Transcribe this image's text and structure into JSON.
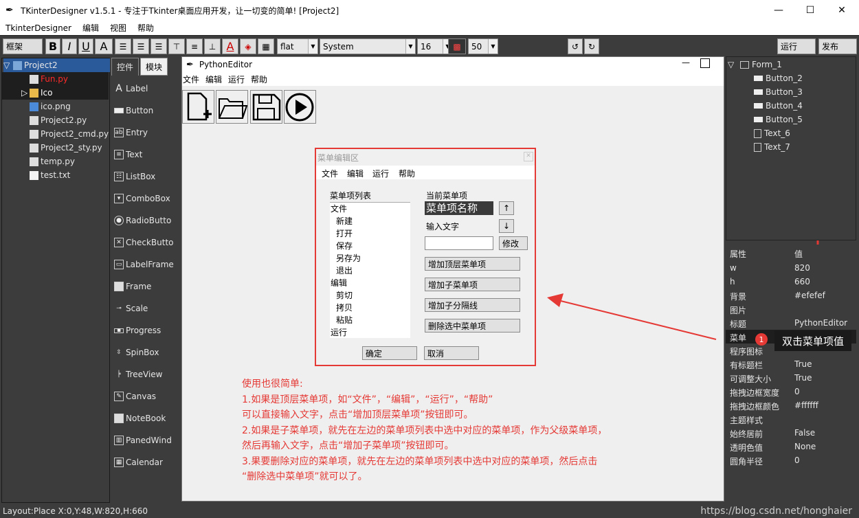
{
  "window": {
    "title": "TKinterDesigner v1.5.1 - 专注于Tkinter桌面应用开发，让一切变的简单!   [Project2]",
    "minimize": "—",
    "maximize": "☐",
    "close": "✕"
  },
  "menubar": [
    "TkinterDesigner",
    "编辑",
    "视图",
    "帮助"
  ],
  "toolbar": {
    "frame_label": "框架",
    "bold": "B",
    "italic": "I",
    "underline": "U",
    "font_color": "A",
    "relief": "flat",
    "font": "System",
    "size": "16",
    "alpha": "50",
    "run": "运行",
    "publish": "发布"
  },
  "project_tree": [
    {
      "label": "Project2",
      "icon": "project-icon",
      "color": "#e6e6e6"
    },
    {
      "label": "Fun.py",
      "icon": "python-file-icon",
      "color": "#ff2a2a"
    },
    {
      "label": "Ico",
      "icon": "folder-icon",
      "color": "#ffffff"
    },
    {
      "label": "ico.png",
      "icon": "image-file-icon",
      "color": "#e6e6e6"
    },
    {
      "label": "Project2.py",
      "icon": "python-file-icon",
      "color": "#e6e6e6"
    },
    {
      "label": "Project2_cmd.py",
      "icon": "python-file-icon",
      "color": "#e6e6e6"
    },
    {
      "label": "Project2_sty.py",
      "icon": "python-file-icon",
      "color": "#e6e6e6"
    },
    {
      "label": "temp.py",
      "icon": "python-file-icon",
      "color": "#e6e6e6"
    },
    {
      "label": "test.txt",
      "icon": "text-file-icon",
      "color": "#e6e6e6"
    }
  ],
  "control_tabs": [
    "控件",
    "模块"
  ],
  "controls": [
    "Label",
    "Button",
    "Entry",
    "Text",
    "ListBox",
    "ComboBox",
    "RadioButto",
    "CheckButto",
    "LabelFrame",
    "Frame",
    "Scale",
    "Progress",
    "SpinBox",
    "TreeView",
    "Canvas",
    "NoteBook",
    "PanedWind",
    "Calendar"
  ],
  "form": {
    "title": "PythonEditor",
    "menu": [
      "文件",
      "编辑",
      "运行",
      "帮助"
    ],
    "toolbar_icons": [
      "new-file-icon",
      "open-folder-icon",
      "save-icon",
      "play-icon"
    ]
  },
  "dialog": {
    "title": "菜单编辑区",
    "menu": [
      "文件",
      "编辑",
      "运行",
      "帮助"
    ],
    "list_label": "菜单项列表",
    "list_items": [
      {
        "text": "文件",
        "indent": 0
      },
      {
        "text": "新建",
        "indent": 1
      },
      {
        "text": "打开",
        "indent": 1
      },
      {
        "text": "保存",
        "indent": 1
      },
      {
        "text": "另存为",
        "indent": 1
      },
      {
        "text": "退出",
        "indent": 1
      },
      {
        "text": "编辑",
        "indent": 0
      },
      {
        "text": "剪切",
        "indent": 1
      },
      {
        "text": "拷贝",
        "indent": 1
      },
      {
        "text": "粘贴",
        "indent": 1
      },
      {
        "text": "运行",
        "indent": 0
      }
    ],
    "current_label": "当前菜单项",
    "current_value": "菜单项名称",
    "up": "↑",
    "down": "↓",
    "input_label": "输入文字",
    "input_value": "",
    "modify": "修改",
    "add_top": "增加顶层菜单项",
    "add_sub": "增加子菜单项",
    "add_sep": "增加子分隔线",
    "delete": "删除选中菜单项",
    "ok": "确定",
    "cancel": "取消"
  },
  "object_tree": [
    "Form_1",
    "Button_2",
    "Button_3",
    "Button_4",
    "Button_5",
    "Text_6",
    "Text_7"
  ],
  "properties": {
    "header": [
      "属性",
      "值"
    ],
    "rows": [
      [
        "w",
        "820"
      ],
      [
        "h",
        "660"
      ],
      [
        "背景",
        "#efefef"
      ],
      [
        "图片",
        ""
      ],
      [
        "标题",
        "PythonEditor"
      ],
      [
        "菜单",
        ""
      ],
      [
        "程序图标",
        ""
      ],
      [
        "有标题栏",
        "True"
      ],
      [
        "可调整大小",
        "True"
      ],
      [
        "拖拽边框宽度",
        "0"
      ],
      [
        "拖拽边框颜色",
        "#ffffff"
      ],
      [
        "主题样式",
        ""
      ],
      [
        "始终居前",
        "False"
      ],
      [
        "透明色值",
        "None"
      ],
      [
        "圆角半径",
        "0"
      ]
    ]
  },
  "callout": {
    "badge": "1",
    "text": "双击菜单项值"
  },
  "note": [
    "使用也很简单:",
    "1.如果是顶层菜单项，如“文件”，“编辑”，“运行”，“帮助”",
    "可以直接输入文字，点击“增加顶层菜单项”按钮即可。",
    "2.如果是子菜单项，就先在左边的菜单项列表中选中对应的菜单项，作为父级菜单项，",
    "然后再输入文字，点击“增加子菜单项”按钮即可。",
    "3.果要删除对应的菜单项，就先在左边的菜单项列表中选中对应的菜单项，然后点击",
    "“删除选中菜单项”就可以了。"
  ],
  "status": "Layout:Place  X:0,Y:48,W:820,H:660",
  "watermark": "https://blog.csdn.net/honghaier",
  "colors": {
    "accent_red": "#e53935",
    "panel_bg": "#3c3c3c",
    "selected_bg": "#1e1e1e"
  }
}
